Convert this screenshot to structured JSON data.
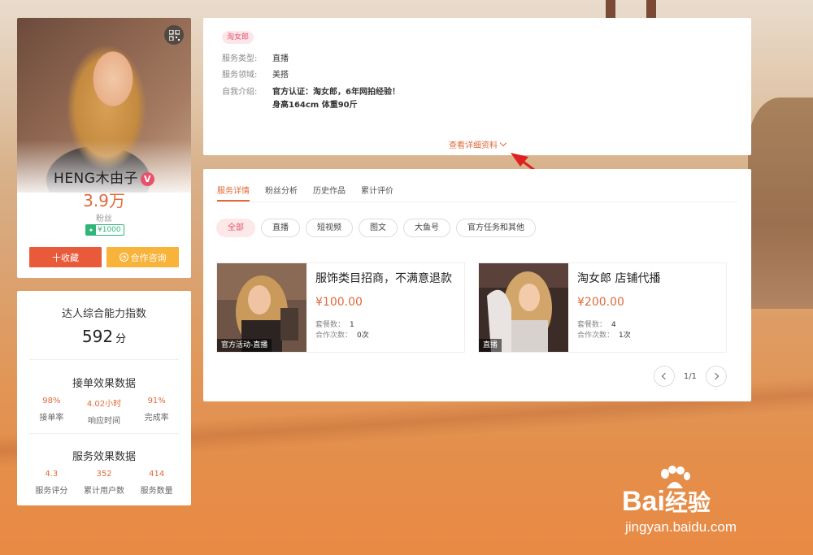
{
  "profile": {
    "name": "HENG木由子",
    "verified_mark": "V",
    "fans_count": "3.9万",
    "fans_label": "粉丝",
    "level_badge": "¥1000",
    "follow_button": "十收藏",
    "consult_button": "合作咨询"
  },
  "ability": {
    "title": "达人综合能力指数",
    "score": "592",
    "score_unit": "分"
  },
  "order_effect": {
    "title": "接单效果数据",
    "metrics": [
      {
        "value": "98%",
        "label": "接单率"
      },
      {
        "value": "4.02小时",
        "label": "响应时间"
      },
      {
        "value": "91%",
        "label": "完成率"
      }
    ]
  },
  "service_effect": {
    "title": "服务效果数据",
    "metrics": [
      {
        "value": "4.3",
        "label": "服务评分"
      },
      {
        "value": "352",
        "label": "累计用户数"
      },
      {
        "value": "414",
        "label": "服务数量"
      }
    ]
  },
  "info": {
    "tag": "淘女郎",
    "rows": [
      {
        "key": "服务类型:",
        "value": "直播"
      },
      {
        "key": "服务领域:",
        "value": "美搭"
      },
      {
        "key": "自我介绍:",
        "value": "官方认证：淘女郎，6年网拍经验！",
        "value2": "身高164cm 体重90斤"
      }
    ],
    "detail_link": "查看详细资料"
  },
  "service": {
    "tabs": [
      "服务详情",
      "粉丝分析",
      "历史作品",
      "累计评价"
    ],
    "active_tab": 0,
    "filters": [
      "全部",
      "直播",
      "短视频",
      "图文",
      "大鱼号",
      "官方任务和其他"
    ],
    "products": [
      {
        "title": "服饰类目招商，不满意退款",
        "price": "¥100.00",
        "thumb_label": "官方活动-直播",
        "packages_label": "套餐数：",
        "packages": "1",
        "orders_label": "合作次数：",
        "orders": "0次"
      },
      {
        "title": "淘女郎 店铺代播",
        "price": "¥200.00",
        "thumb_label": "直播",
        "packages_label": "套餐数：",
        "packages": "4",
        "orders_label": "合作次数：",
        "orders": "1次"
      }
    ],
    "pagination": "1/1"
  },
  "watermark": {
    "brand": "Bai",
    "brand_suffix": "经验",
    "url": "jingyan.baidu.com"
  },
  "colors": {
    "accent": "#e06a3b",
    "follow": "#e85a3a",
    "consult": "#f7b33a",
    "tag_pink": "#e0566f"
  },
  "icons": [
    "qr-code-icon",
    "verified-icon",
    "level-icon",
    "consult-icon",
    "chevron-down-icon",
    "arrow-left-icon",
    "arrow-right-icon",
    "baidu-paw-icon"
  ]
}
